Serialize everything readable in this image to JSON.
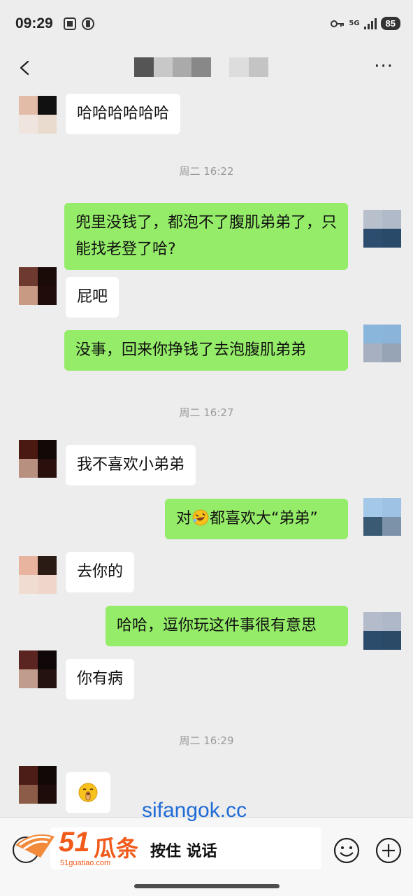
{
  "status_bar": {
    "time": "09:29",
    "network": "5G",
    "battery": "85"
  },
  "header": {
    "title": ""
  },
  "messages": [
    {
      "side": "in",
      "text": "哈哈哈哈哈哈"
    },
    {
      "timestamp": "周二 16:22"
    },
    {
      "side": "out",
      "text": "兜里没钱了，都泡不了腹肌弟弟了，只能找老登了哈?"
    },
    {
      "side": "in",
      "text": "屁吧"
    },
    {
      "side": "out",
      "text": "没事，回来你挣钱了去泡腹肌弟弟"
    },
    {
      "timestamp": "周二 16:27"
    },
    {
      "side": "in",
      "text": "我不喜欢小弟弟"
    },
    {
      "side": "out",
      "text_before": "对",
      "emoji": "rolling-laughing-emoji",
      "text_after": "都喜欢大“弟弟”"
    },
    {
      "side": "in",
      "text": "去你的"
    },
    {
      "side": "out",
      "text": "哈哈，逗你玩这件事很有意思"
    },
    {
      "side": "in",
      "text": "你有病"
    },
    {
      "timestamp": "周二 16:29"
    },
    {
      "side": "in",
      "emoji": "shushing-face-emoji"
    }
  ],
  "input_bar": {
    "hold_to_talk": "按住 说话"
  },
  "watermark": {
    "site": "sifangok.cc",
    "logo_number": "51",
    "logo_text": "瓜条",
    "logo_sub": "51guatiao.com"
  },
  "colors": {
    "outgoing_bubble": "#95ec69",
    "incoming_bubble": "#ffffff",
    "background": "#ededed"
  }
}
